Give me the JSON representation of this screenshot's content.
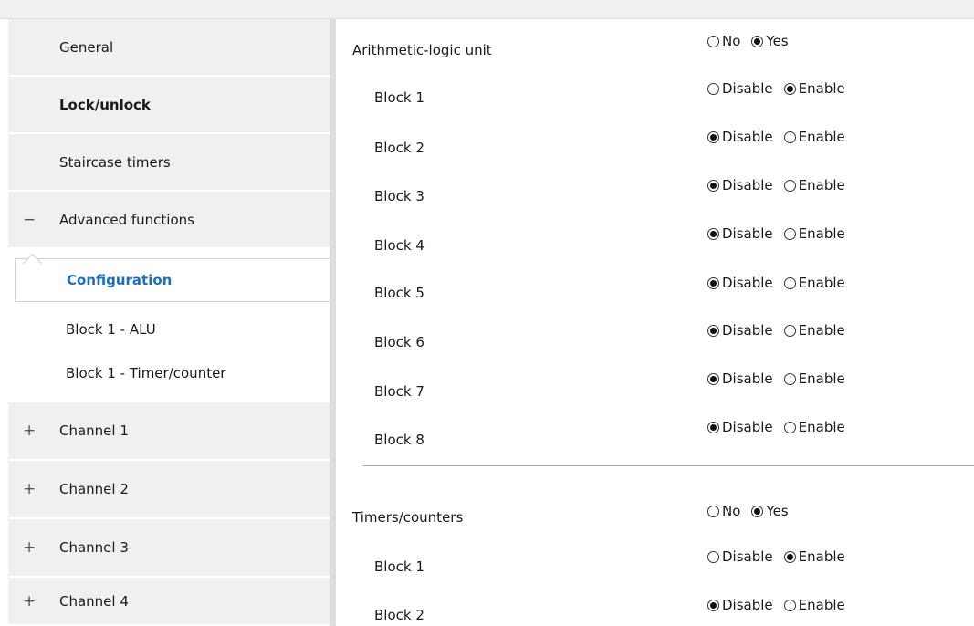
{
  "sidebar": {
    "items": [
      {
        "label": "General",
        "toggle": ""
      },
      {
        "label": "Lock/unlock",
        "toggle": ""
      },
      {
        "label": "Staircase timers",
        "toggle": ""
      },
      {
        "label": "Advanced functions",
        "toggle": "−"
      },
      {
        "label": "Channel 1",
        "toggle": "+"
      },
      {
        "label": "Channel 2",
        "toggle": "+"
      },
      {
        "label": "Channel 3",
        "toggle": "+"
      },
      {
        "label": "Channel 4",
        "toggle": "+"
      }
    ],
    "subitems": [
      {
        "label": "Configuration"
      },
      {
        "label": "Block 1 - ALU"
      },
      {
        "label": "Block 1 - Timer/counter"
      }
    ]
  },
  "main": {
    "alu": {
      "label": "Arithmetic-logic unit",
      "opt_a": "No",
      "opt_b": "Yes",
      "selected": "Yes",
      "blocks": [
        {
          "label": "Block 1",
          "opt_a": "Disable",
          "opt_b": "Enable",
          "selected": "Enable"
        },
        {
          "label": "Block 2",
          "opt_a": "Disable",
          "opt_b": "Enable",
          "selected": "Disable"
        },
        {
          "label": "Block 3",
          "opt_a": "Disable",
          "opt_b": "Enable",
          "selected": "Disable"
        },
        {
          "label": "Block 4",
          "opt_a": "Disable",
          "opt_b": "Enable",
          "selected": "Disable"
        },
        {
          "label": "Block 5",
          "opt_a": "Disable",
          "opt_b": "Enable",
          "selected": "Disable"
        },
        {
          "label": "Block 6",
          "opt_a": "Disable",
          "opt_b": "Enable",
          "selected": "Disable"
        },
        {
          "label": "Block 7",
          "opt_a": "Disable",
          "opt_b": "Enable",
          "selected": "Disable"
        },
        {
          "label": "Block 8",
          "opt_a": "Disable",
          "opt_b": "Enable",
          "selected": "Disable"
        }
      ]
    },
    "timers": {
      "label": "Timers/counters",
      "opt_a": "No",
      "opt_b": "Yes",
      "selected": "Yes",
      "blocks": [
        {
          "label": "Block 1",
          "opt_a": "Disable",
          "opt_b": "Enable",
          "selected": "Enable"
        },
        {
          "label": "Block 2",
          "opt_a": "Disable",
          "opt_b": "Enable",
          "selected": "Disable"
        }
      ]
    }
  }
}
